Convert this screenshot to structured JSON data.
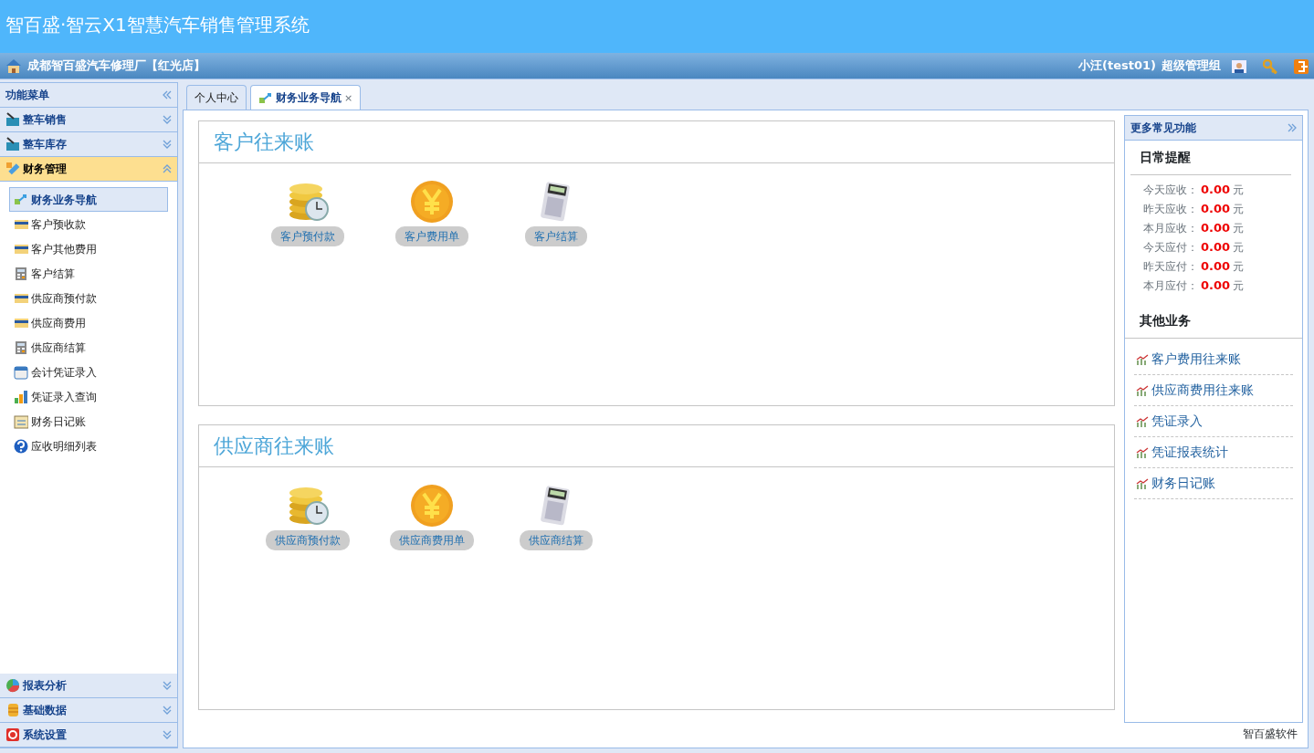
{
  "header": {
    "title": "智百盛·智云X1智慧汽车销售管理系统"
  },
  "subbar": {
    "shop": "成都智百盛汽车修理厂【红光店】",
    "user": "小汪(test01)",
    "role": "超级管理组"
  },
  "sidebar": {
    "title": "功能菜单",
    "groups": [
      {
        "label": "整车销售",
        "kind": "basket",
        "expanded": false
      },
      {
        "label": "整车库存",
        "kind": "basket",
        "expanded": false
      },
      {
        "label": "财务管理",
        "kind": "pencil",
        "expanded": true,
        "items": [
          {
            "label": "财务业务导航",
            "kind": "arrows",
            "selected": true
          },
          {
            "label": "客户预收款",
            "kind": "card",
            "selected": false
          },
          {
            "label": "客户其他费用",
            "kind": "card",
            "selected": false
          },
          {
            "label": "客户结算",
            "kind": "calc",
            "selected": false
          },
          {
            "label": "供应商预付款",
            "kind": "card",
            "selected": false
          },
          {
            "label": "供应商费用",
            "kind": "card",
            "selected": false
          },
          {
            "label": "供应商结算",
            "kind": "calc",
            "selected": false
          },
          {
            "label": "会计凭证录入",
            "kind": "calendar",
            "selected": false
          },
          {
            "label": "凭证录入查询",
            "kind": "bars",
            "selected": false
          },
          {
            "label": "财务日记账",
            "kind": "note",
            "selected": false
          },
          {
            "label": "应收明细列表",
            "kind": "help",
            "selected": false
          }
        ]
      },
      {
        "label": "报表分析",
        "kind": "pie",
        "expanded": false
      },
      {
        "label": "基础数据",
        "kind": "db",
        "expanded": false
      },
      {
        "label": "系统设置",
        "kind": "gear",
        "expanded": false
      }
    ]
  },
  "tabs": [
    {
      "label": "个人中心",
      "selected": false
    },
    {
      "label": "财务业务导航",
      "selected": true,
      "close": "×"
    }
  ],
  "sections": [
    {
      "title": "客户往来账",
      "tiles": [
        {
          "label": "客户预付款",
          "kind": "coins"
        },
        {
          "label": "客户费用单",
          "kind": "yen"
        },
        {
          "label": "客户结算",
          "kind": "calc"
        }
      ]
    },
    {
      "title": "供应商往来账",
      "tiles": [
        {
          "label": "供应商预付款",
          "kind": "coins"
        },
        {
          "label": "供应商费用单",
          "kind": "yen"
        },
        {
          "label": "供应商结算",
          "kind": "calc"
        }
      ]
    }
  ],
  "side_panel": {
    "title": "更多常见功能",
    "reminders_title": "日常提醒",
    "reminders": [
      {
        "label": "今天应收：",
        "value": "0.00",
        "unit": "元"
      },
      {
        "label": "昨天应收：",
        "value": "0.00",
        "unit": "元"
      },
      {
        "label": "本月应收：",
        "value": "0.00",
        "unit": "元"
      },
      {
        "label": "今天应付：",
        "value": "0.00",
        "unit": "元"
      },
      {
        "label": "昨天应付：",
        "value": "0.00",
        "unit": "元"
      },
      {
        "label": "本月应付：",
        "value": "0.00",
        "unit": "元"
      }
    ],
    "other_title": "其他业务",
    "links": [
      "客户费用往来账",
      "供应商费用往来账",
      "凭证录入",
      "凭证报表统计",
      "财务日记账"
    ]
  },
  "footer": "智百盛软件"
}
